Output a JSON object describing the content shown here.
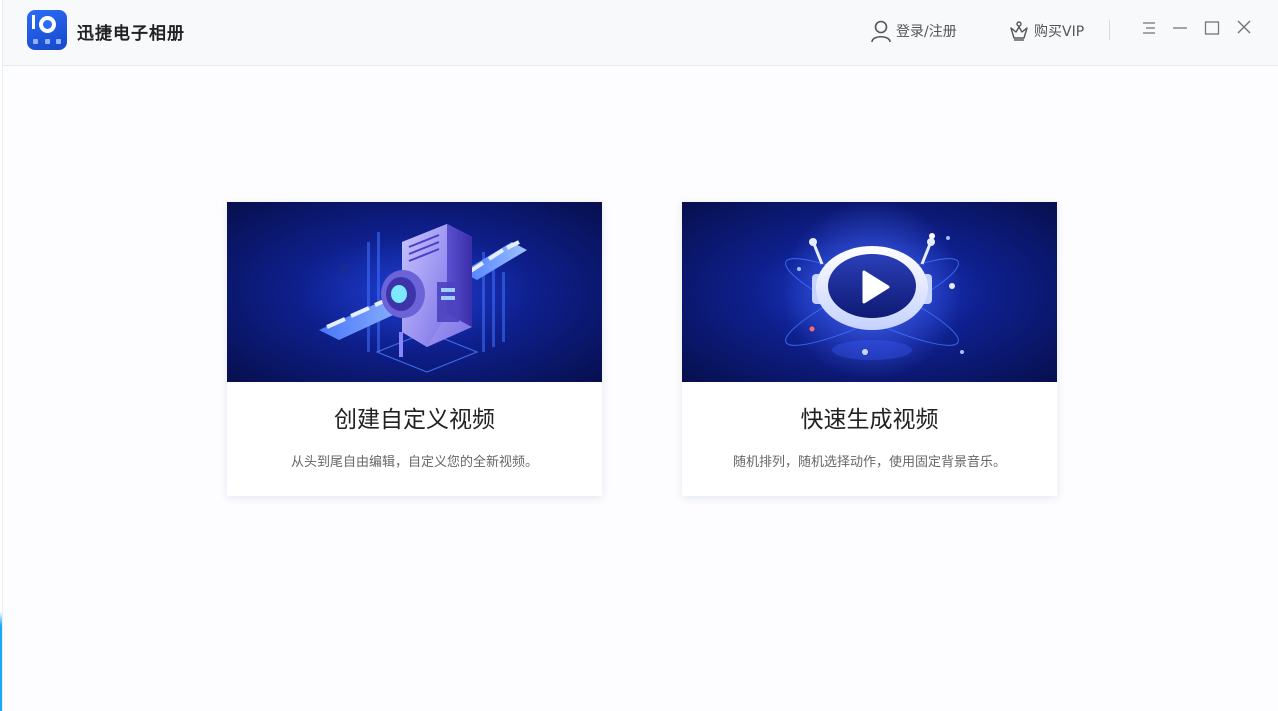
{
  "app": {
    "title": "迅捷电子相册",
    "logo_icon": "photo-album-logo-icon"
  },
  "header": {
    "login_label": "登录/注册",
    "login_icon": "user-icon",
    "vip_label": "购买VIP",
    "vip_icon": "crown-icon"
  },
  "window_controls": [
    "menu-icon",
    "minimize-icon",
    "maximize-icon",
    "close-icon"
  ],
  "colors": {
    "accent": "#2b6cf6",
    "banner_dark": "#070f4d",
    "banner_bright": "#1f3fd6"
  },
  "cards": [
    {
      "title": "创建自定义视频",
      "description": "从头到尾自由编辑，自定义您的全新视频。",
      "illustration": "film-machine-illustration"
    },
    {
      "title": "快速生成视频",
      "description": "随机排列，随机选择动作，使用固定背景音乐。",
      "illustration": "play-button-illustration"
    }
  ]
}
